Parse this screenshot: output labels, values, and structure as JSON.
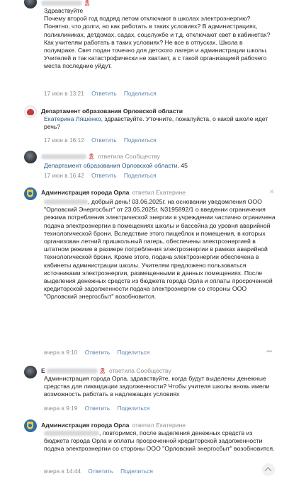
{
  "flag_emoji": "🎗",
  "actions": {
    "reply": "Ответить",
    "share": "Поделиться"
  },
  "comments": [
    {
      "author": "",
      "text": "Здравствуйте\nПочему второй год подряд летом отключают в школах электроэнергию? Понятно, что долги, но как работать в таких условиях? В администрациях, поликлиниках, детдомах, садах, соцслужбе и т.д. отключают свет в кабинетах? Как учителям работать в таких условиях? Не все в отпусках. Школа в полумраке. Свет подан точечно для детского лагеря и администрации школы. Учителей и так катастрофически не хватает, а с такой организацией рабочего места последние уйдут.",
      "time": "17 июн в 13:21"
    },
    {
      "author": "Департамент образования Орловской области",
      "text_link": "Екатерина Ляшенко",
      "text": ", здравствуйте. Уточните, пожалуйста, о какой школе идет речь?",
      "time": "17 июн в 16:12"
    },
    {
      "author": "",
      "replied_prefix": "ответила",
      "replied_to": "Сообществу",
      "text_link": "Департамент образования Орловской области",
      "text": ", 45",
      "time": "17 июн в 16:42"
    },
    {
      "author": "Администрация города Орла",
      "replied_prefix": "ответил",
      "replied_to": "Екатерине",
      "text": ", добрый день! 03.06.2025г. на основании уведомления ООО \"Орловский Энергосбыт\" от 23.05.2025г. N3195892/1 о введении ограничения режима потребления электрической энергии в учреждении частично ограничена подача электроэнергии в помещениях школы и бассейна до уровня аварийной технологической брони. Вследствие этого пищеблок и помещения, в которых организован летний пришкольный лагерь, обеспечены электроэнергией в штатном режиме в размере потребления электроэнергии в рамках аварийной технологической брони. Кроме этого, подача электроэнергии обеспечена в кабинеты администрации школы. Учителям предложено пользоваться источниками электроэнергии, размещенными в данных помещениях. После выделения денежных средств из бюджета города Орла и оплаты просроченной кредиторской задолженности подача электроэнергии со стороны ООО \"Орловский энергосбыт\" возобновится.",
      "time": "вчера в 9:10"
    },
    {
      "author": "Е",
      "replied_prefix": "ответила",
      "replied_to": "Сообществу",
      "text": "Администрация города Орла, здравствуйте, когда будут выделены денежные средства для ликвидации задолженности? Чтобы учителя школы вновь имели возможность работать в надлежащих условиях",
      "time": "вчера в 9:19"
    },
    {
      "author": "Администрация города Орла",
      "replied_prefix": "ответил",
      "replied_to": "Екатерине",
      "text": ", повторимся, после выделения денежных средств из бюджета города Орла и оплаты просроченной кредиторской задолженности подача электроэнергии со стороны ООО \"Орловский энергосбыт\" возобновится.",
      "time": "вчера в 14:44"
    }
  ]
}
